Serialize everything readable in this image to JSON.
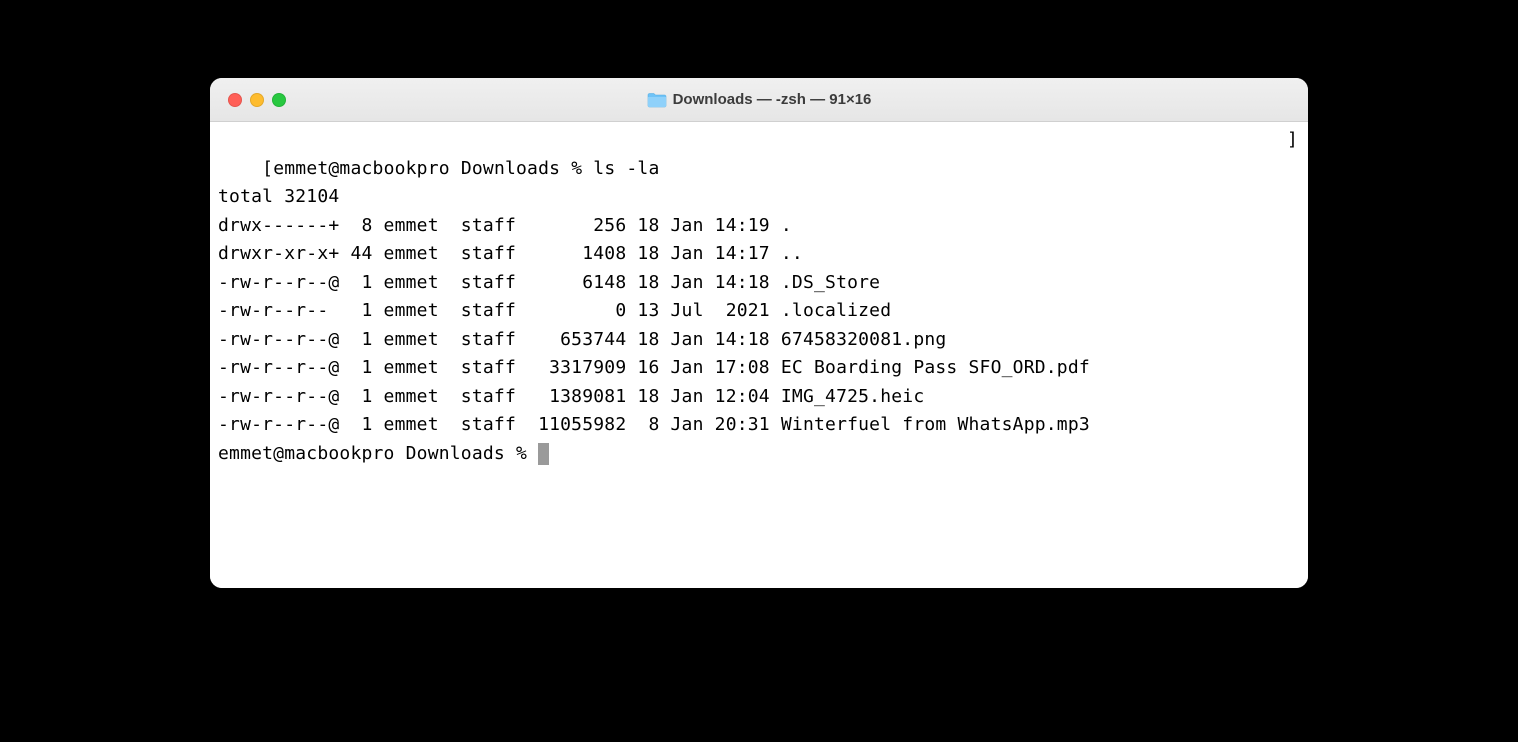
{
  "window": {
    "title": "Downloads — -zsh — 91×16"
  },
  "terminal": {
    "prompt1": "emmet@macbookpro Downloads % ",
    "command1": "ls -la",
    "total_line": "total 32104",
    "entries": [
      {
        "perms": "drwx------+",
        "links": " 8",
        "owner": "emmet",
        "group": "staff",
        "size": "     256",
        "date": "18 Jan 14:19",
        "name": "."
      },
      {
        "perms": "drwxr-xr-x+",
        "links": "44",
        "owner": "emmet",
        "group": "staff",
        "size": "    1408",
        "date": "18 Jan 14:17",
        "name": ".."
      },
      {
        "perms": "-rw-r--r--@",
        "links": " 1",
        "owner": "emmet",
        "group": "staff",
        "size": "    6148",
        "date": "18 Jan 14:18",
        "name": ".DS_Store"
      },
      {
        "perms": "-rw-r--r-- ",
        "links": " 1",
        "owner": "emmet",
        "group": "staff",
        "size": "       0",
        "date": "13 Jul  2021",
        "name": ".localized"
      },
      {
        "perms": "-rw-r--r--@",
        "links": " 1",
        "owner": "emmet",
        "group": "staff",
        "size": "  653744",
        "date": "18 Jan 14:18",
        "name": "67458320081.png"
      },
      {
        "perms": "-rw-r--r--@",
        "links": " 1",
        "owner": "emmet",
        "group": "staff",
        "size": " 3317909",
        "date": "16 Jan 17:08",
        "name": "EC Boarding Pass SFO_ORD.pdf"
      },
      {
        "perms": "-rw-r--r--@",
        "links": " 1",
        "owner": "emmet",
        "group": "staff",
        "size": " 1389081",
        "date": "18 Jan 12:04",
        "name": "IMG_4725.heic"
      },
      {
        "perms": "-rw-r--r--@",
        "links": " 1",
        "owner": "emmet",
        "group": "staff",
        "size": "11055982",
        "date": " 8 Jan 20:31",
        "name": "Winterfuel from WhatsApp.mp3"
      }
    ],
    "prompt2": "emmet@macbookpro Downloads % "
  }
}
